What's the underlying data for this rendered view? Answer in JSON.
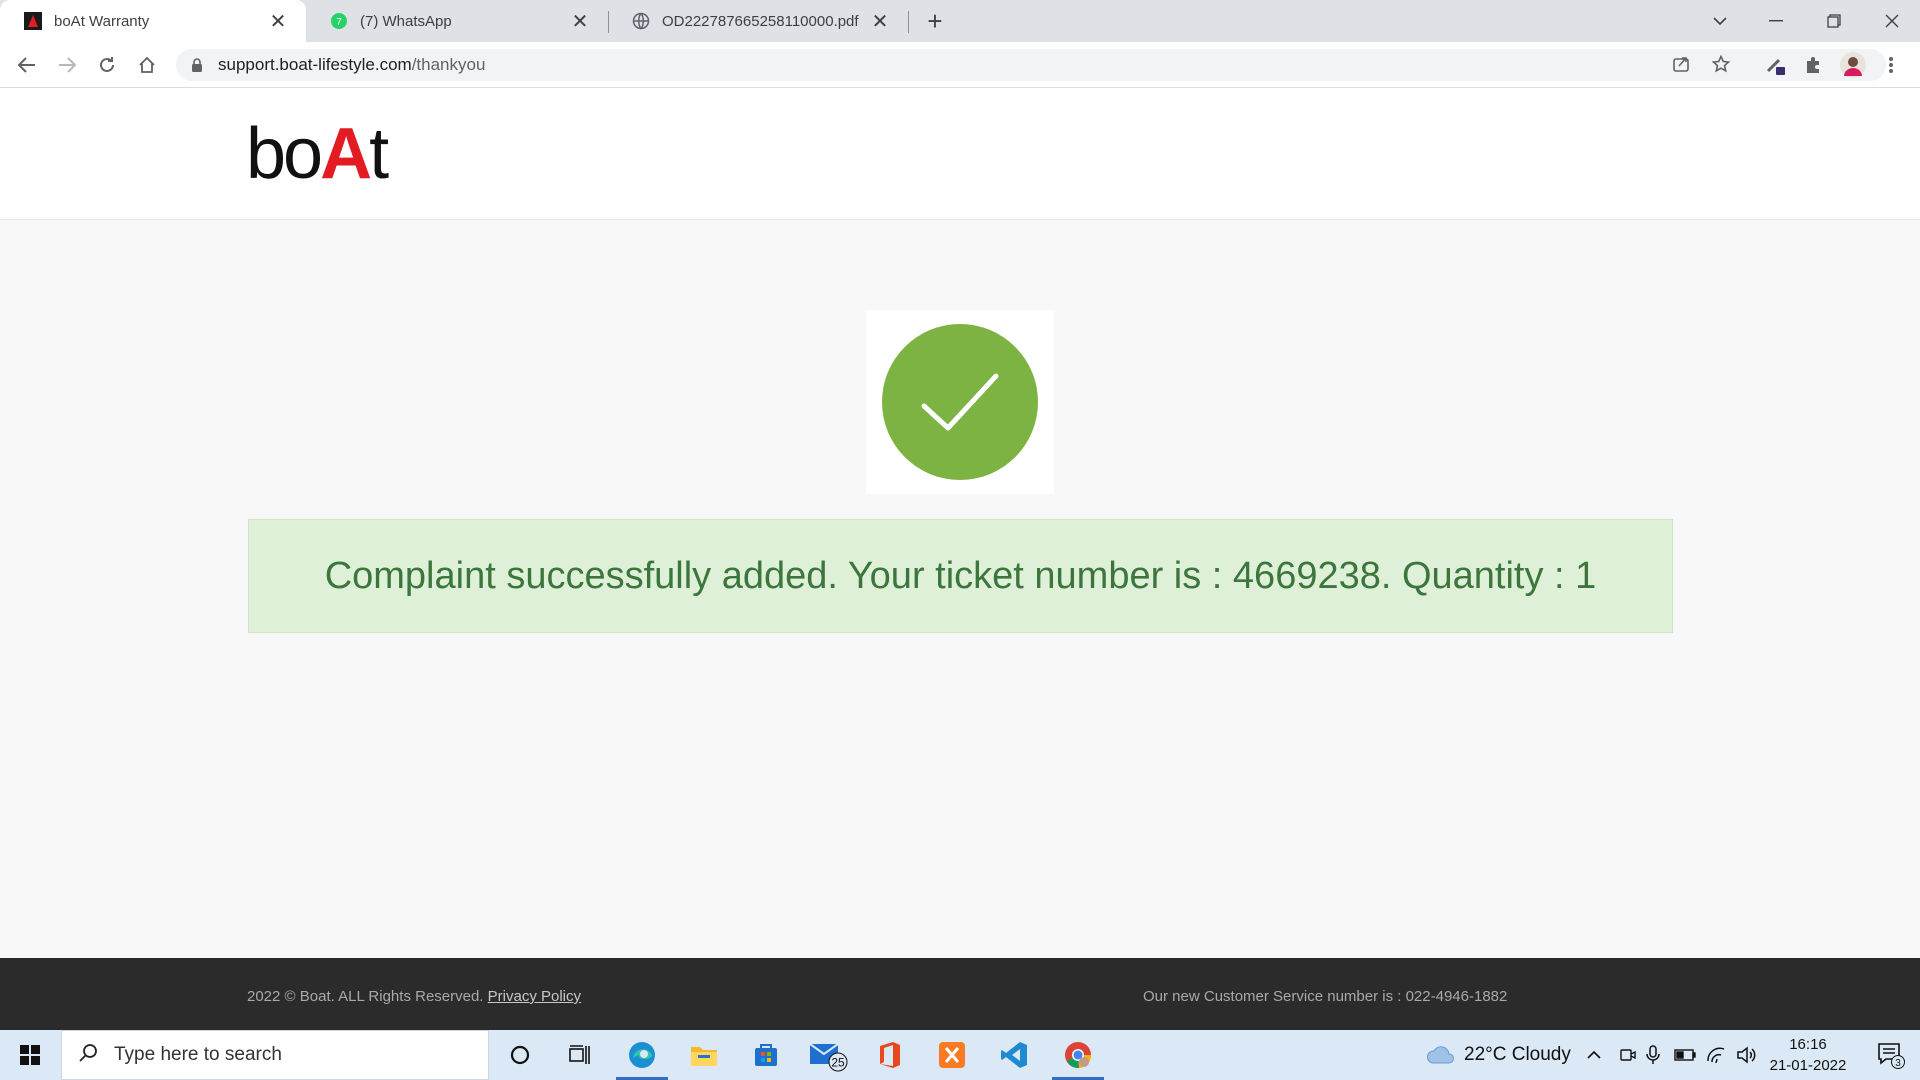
{
  "browser": {
    "tabs": [
      {
        "title": "boAt Warranty",
        "active": true
      },
      {
        "title": "(7) WhatsApp",
        "active": false
      },
      {
        "title": "OD222787665258110000.pdf",
        "active": false
      }
    ],
    "close_glyph": "✕",
    "new_tab_glyph": "+",
    "address": {
      "host": "support.boat-lifestyle.com",
      "path": "/thankyou"
    },
    "whatsapp_badge": "7"
  },
  "site": {
    "logo": {
      "part1": "bo",
      "part2": "A",
      "part3": "t"
    },
    "message": "Complaint successfully added. Your ticket number is : 4669238. Quantity : 1",
    "footer": {
      "copyright": "2022 © Boat. ALL Rights Reserved.",
      "privacy_link": "Privacy Policy",
      "service": "Our new Customer Service number is : 022-4946-1882"
    },
    "colors": {
      "brand_red": "#e31b23",
      "success_green": "#7cb342",
      "alert_bg": "#dff0d8",
      "alert_text": "#3c763d"
    }
  },
  "taskbar": {
    "search_placeholder": "Type here to search",
    "mail_badge": "25",
    "weather": "22°C  Cloudy",
    "time": "16:16",
    "date": "21-01-2022",
    "notification_count": "3"
  }
}
